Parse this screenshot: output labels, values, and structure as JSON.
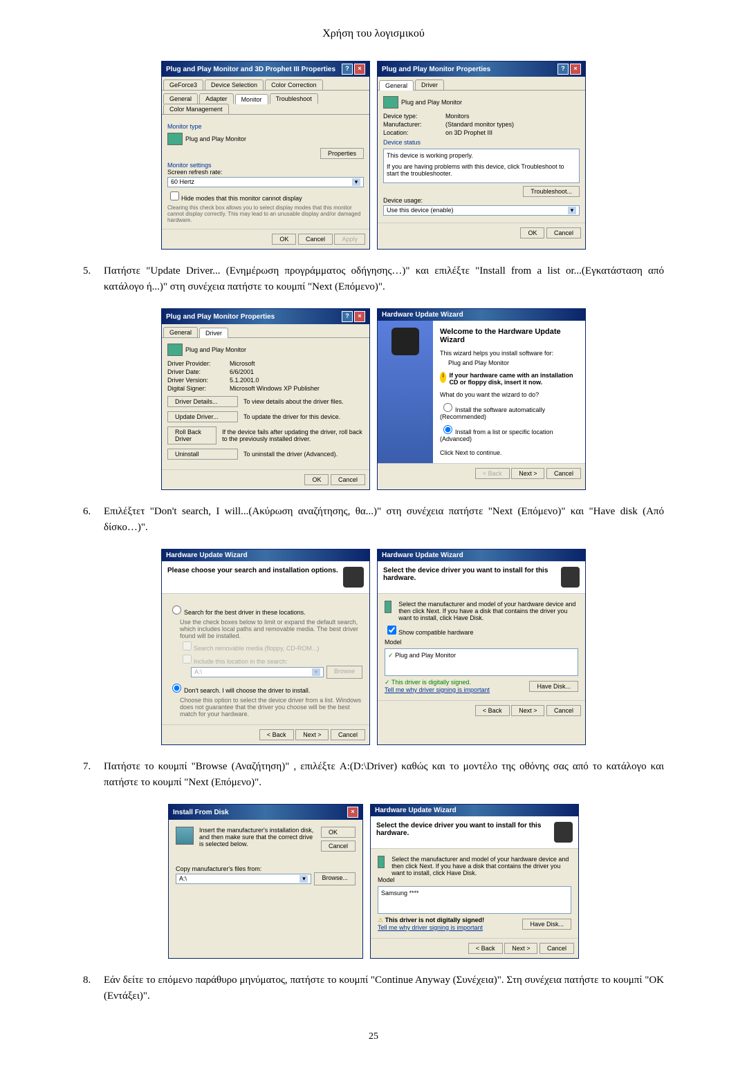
{
  "header": "Χρήση του λογισμικού",
  "page_number": "25",
  "steps": {
    "s5": {
      "num": "5.",
      "text": "Πατήστε \"Update Driver... (Ενημέρωση προγράμματος οδήγησης…)\" και επιλέξτε \"Install from a list or...(Εγκατάσταση από κατάλογο ή...)\" στη συνέχεια πατήστε το κουμπί \"Next (Επόμενο)\"."
    },
    "s6": {
      "num": "6.",
      "text": "Επιλέξτετ \"Don't search, I will...(Ακύρωση αναζήτησης, θα...)\" στη συνέχεια πατήστε \"Next (Επόμενο)\" και \"Have disk (Από δίσκο…)\"."
    },
    "s7": {
      "num": "7.",
      "text": "Πατήστε το κουμπί \"Browse (Αναζήτηση)\" , επιλέξτε A:(D:\\Driver) καθώς και το μοντέλο της οθόνης σας από το κατάλογο και πατήστε το κουμπί \"Next (Επόμενο)\"."
    },
    "s8": {
      "num": "8.",
      "text": "Εάν δείτε το επόμενο παράθυρο μηνύματος, πατήστε το κουμπί \"Continue Anyway (Συνέχεια)\". Στη συνέχεια πατήστε το κουμπί \"OK (Εντάξει)\"."
    }
  },
  "win1": {
    "title": "Plug and Play Monitor and 3D Prophet III Properties",
    "tabs_row1": [
      "GeForce3",
      "Device Selection",
      "Color Correction"
    ],
    "tabs_row2": [
      "General",
      "Adapter",
      "Monitor",
      "Troubleshoot",
      "Color Management"
    ],
    "monitor_type": "Monitor type",
    "monitor_name": "Plug and Play Monitor",
    "properties": "Properties",
    "monitor_settings": "Monitor settings",
    "refresh_rate_label": "Screen refresh rate:",
    "refresh_rate": "60 Hertz",
    "hide_modes": "Hide modes that this monitor cannot display",
    "hide_modes_desc": "Clearing this check box allows you to select display modes that this monitor cannot display correctly. This may lead to an unusable display and/or damaged hardware.",
    "ok": "OK",
    "cancel": "Cancel",
    "apply": "Apply"
  },
  "win2": {
    "title": "Plug and Play Monitor Properties",
    "tab_general": "General",
    "tab_driver": "Driver",
    "device_name": "Plug and Play Monitor",
    "device_type_lbl": "Device type:",
    "device_type": "Monitors",
    "manufacturer_lbl": "Manufacturer:",
    "manufacturer": "(Standard monitor types)",
    "location_lbl": "Location:",
    "location": "on 3D Prophet III",
    "device_status": "Device status",
    "status_text": "This device is working properly.",
    "status_text2": "If you are having problems with this device, click Troubleshoot to start the troubleshooter.",
    "troubleshoot": "Troubleshoot...",
    "device_usage": "Device usage:",
    "usage_value": "Use this device (enable)",
    "ok": "OK",
    "cancel": "Cancel"
  },
  "win3": {
    "title": "Plug and Play Monitor Properties",
    "tab_general": "General",
    "tab_driver": "Driver",
    "device_name": "Plug and Play Monitor",
    "provider_lbl": "Driver Provider:",
    "provider": "Microsoft",
    "date_lbl": "Driver Date:",
    "date": "6/6/2001",
    "version_lbl": "Driver Version:",
    "version": "5.1.2001.0",
    "signer_lbl": "Digital Signer:",
    "signer": "Microsoft Windows XP Publisher",
    "btn_details": "Driver Details...",
    "btn_details_desc": "To view details about the driver files.",
    "btn_update": "Update Driver...",
    "btn_update_desc": "To update the driver for this device.",
    "btn_rollback": "Roll Back Driver",
    "btn_rollback_desc": "If the device fails after updating the driver, roll back to the previously installed driver.",
    "btn_uninstall": "Uninstall",
    "btn_uninstall_desc": "To uninstall the driver (Advanced).",
    "ok": "OK",
    "cancel": "Cancel"
  },
  "win4": {
    "title": "Hardware Update Wizard",
    "welcome": "Welcome to the Hardware Update Wizard",
    "helps": "This wizard helps you install software for:",
    "device": "Plug and Play Monitor",
    "cd_hint": "If your hardware came with an installation CD or floppy disk, insert it now.",
    "what_do": "What do you want the wizard to do?",
    "opt_auto": "Install the software automatically (Recommended)",
    "opt_list": "Install from a list or specific location (Advanced)",
    "click_next": "Click Next to continue.",
    "back": "< Back",
    "next": "Next >",
    "cancel": "Cancel"
  },
  "win5": {
    "title": "Hardware Update Wizard",
    "header": "Please choose your search and installation options.",
    "opt_search": "Search for the best driver in these locations.",
    "opt_search_desc": "Use the check boxes below to limit or expand the default search, which includes local paths and removable media. The best driver found will be installed.",
    "chk_removable": "Search removable media (floppy, CD-ROM...)",
    "chk_include": "Include this location in the search:",
    "path": "A:\\",
    "browse": "Browse",
    "opt_dont": "Don't search. I will choose the driver to install.",
    "opt_dont_desc": "Choose this option to select the device driver from a list. Windows does not guarantee that the driver you choose will be the best match for your hardware.",
    "back": "< Back",
    "next": "Next >",
    "cancel": "Cancel"
  },
  "win6": {
    "title": "Hardware Update Wizard",
    "header": "Select the device driver you want to install for this hardware.",
    "instr": "Select the manufacturer and model of your hardware device and then click Next. If you have a disk that contains the driver you want to install, click Have Disk.",
    "show_compat": "Show compatible hardware",
    "model": "Model",
    "model_item": "Plug and Play Monitor",
    "signed": "This driver is digitally signed.",
    "tell_why": "Tell me why driver signing is important",
    "have_disk": "Have Disk...",
    "back": "< Back",
    "next": "Next >",
    "cancel": "Cancel"
  },
  "win7": {
    "title": "Install From Disk",
    "instr": "Insert the manufacturer's installation disk, and then make sure that the correct drive is selected below.",
    "ok": "OK",
    "cancel": "Cancel",
    "copy_from": "Copy manufacturer's files from:",
    "path": "A:\\",
    "browse": "Browse..."
  },
  "win8": {
    "title": "Hardware Update Wizard",
    "header": "Select the device driver you want to install for this hardware.",
    "instr": "Select the manufacturer and model of your hardware device and then click Next. If you have a disk that contains the driver you want to install, click Have Disk.",
    "model": "Model",
    "model_item": "Samsung ****",
    "not_signed": "This driver is not digitally signed!",
    "tell_why": "Tell me why driver signing is important",
    "have_disk": "Have Disk...",
    "back": "< Back",
    "next": "Next >",
    "cancel": "Cancel"
  }
}
